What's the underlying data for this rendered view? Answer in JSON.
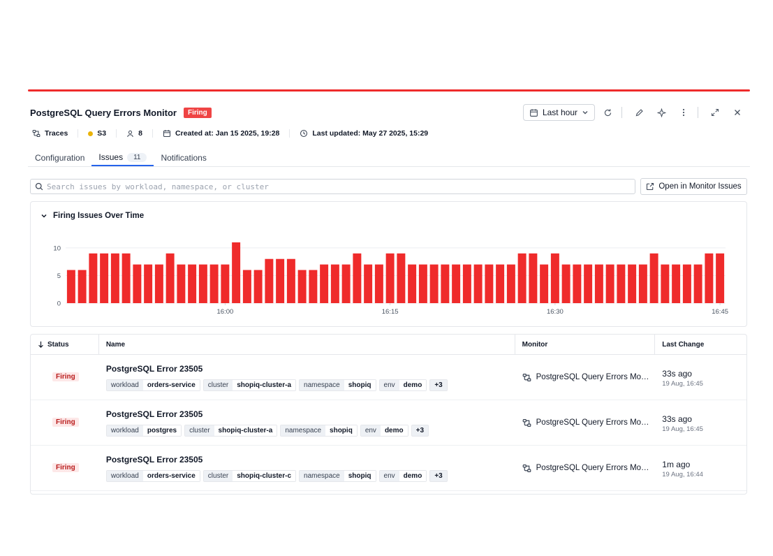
{
  "header": {
    "title": "PostgreSQL Query Errors Monitor",
    "status_badge": "Firing",
    "time_range": "Last hour"
  },
  "meta": {
    "source": "Traces",
    "severity": "S3",
    "assignees": "8",
    "created": "Created at: Jan 15 2025, 19:28",
    "updated": "Last updated: May 27 2025, 15:29"
  },
  "tabs": [
    {
      "label": "Configuration"
    },
    {
      "label": "Issues",
      "count": "11"
    },
    {
      "label": "Notifications"
    }
  ],
  "search": {
    "placeholder": "Search issues by workload, namespace, or cluster",
    "open_button": "Open in Monitor Issues"
  },
  "chart_section": {
    "title": "Firing Issues Over Time"
  },
  "chart_data": {
    "type": "bar",
    "color": "#ef2b2b",
    "ylim": [
      0,
      11
    ],
    "y_ticks": [
      "0",
      "5",
      "10"
    ],
    "y_tick_values": [
      0,
      5,
      10
    ],
    "x_ticks": [
      "16:00",
      "16:15",
      "16:30",
      "16:45"
    ],
    "x_tick_index": [
      14,
      29,
      44,
      59
    ],
    "values": [
      6,
      6,
      9,
      9,
      9,
      9,
      7,
      7,
      7,
      9,
      7,
      7,
      7,
      7,
      7,
      11,
      6,
      6,
      8,
      8,
      8,
      6,
      6,
      7,
      7,
      7,
      9,
      7,
      7,
      9,
      9,
      7,
      7,
      7,
      7,
      7,
      7,
      7,
      7,
      7,
      7,
      9,
      9,
      7,
      9,
      7,
      7,
      7,
      7,
      7,
      7,
      7,
      7,
      9,
      7,
      7,
      7,
      7,
      9,
      9
    ]
  },
  "table": {
    "columns": [
      "Status",
      "Name",
      "Monitor",
      "Last Change"
    ],
    "rows": [
      {
        "status": "Firing",
        "name": "PostgreSQL Error 23505",
        "tags": [
          {
            "k": "workload",
            "v": "orders-service"
          },
          {
            "k": "cluster",
            "v": "shopiq-cluster-a"
          },
          {
            "k": "namespace",
            "v": "shopiq"
          },
          {
            "k": "env",
            "v": "demo"
          }
        ],
        "more": "+3",
        "monitor": "PostgreSQL Query Errors Moni...",
        "last_change": "33s ago",
        "last_change_time": "19 Aug, 16:45"
      },
      {
        "status": "Firing",
        "name": "PostgreSQL Error 23505",
        "tags": [
          {
            "k": "workload",
            "v": "postgres"
          },
          {
            "k": "cluster",
            "v": "shopiq-cluster-a"
          },
          {
            "k": "namespace",
            "v": "shopiq"
          },
          {
            "k": "env",
            "v": "demo"
          }
        ],
        "more": "+3",
        "monitor": "PostgreSQL Query Errors Moni...",
        "last_change": "33s ago",
        "last_change_time": "19 Aug, 16:45"
      },
      {
        "status": "Firing",
        "name": "PostgreSQL Error 23505",
        "tags": [
          {
            "k": "workload",
            "v": "orders-service"
          },
          {
            "k": "cluster",
            "v": "shopiq-cluster-c"
          },
          {
            "k": "namespace",
            "v": "shopiq"
          },
          {
            "k": "env",
            "v": "demo"
          }
        ],
        "more": "+3",
        "monitor": "PostgreSQL Query Errors Moni...",
        "last_change": "1m ago",
        "last_change_time": "19 Aug, 16:44"
      }
    ]
  }
}
